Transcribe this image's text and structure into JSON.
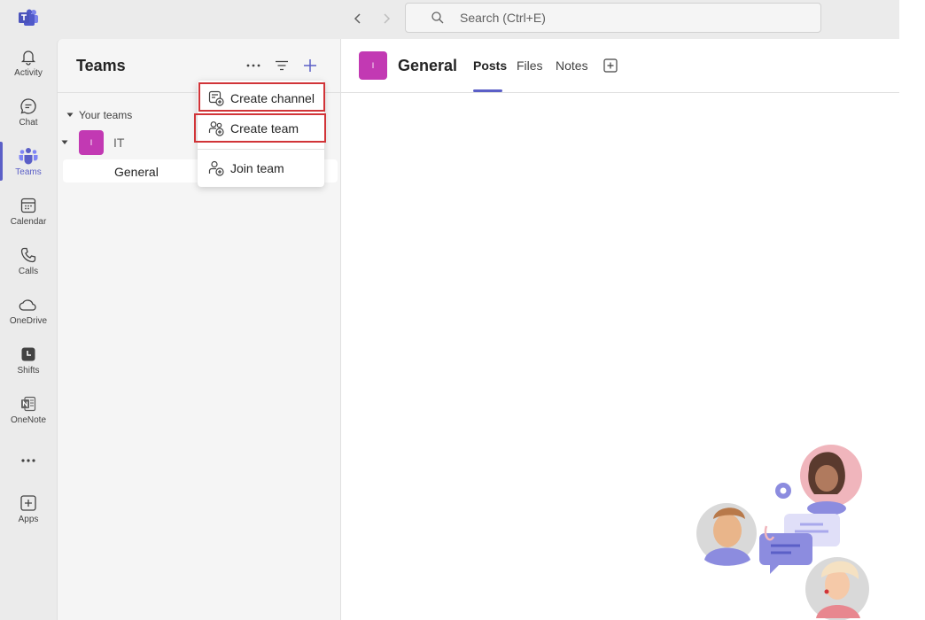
{
  "search": {
    "placeholder": "Search (Ctrl+E)"
  },
  "rail": {
    "items": [
      {
        "label": "Activity",
        "icon": "bell-icon"
      },
      {
        "label": "Chat",
        "icon": "chat-icon"
      },
      {
        "label": "Teams",
        "icon": "teams-icon",
        "active": true
      },
      {
        "label": "Calendar",
        "icon": "calendar-icon"
      },
      {
        "label": "Calls",
        "icon": "phone-icon"
      },
      {
        "label": "OneDrive",
        "icon": "cloud-icon"
      },
      {
        "label": "Shifts",
        "icon": "shifts-icon"
      },
      {
        "label": "OneNote",
        "icon": "onenote-icon"
      },
      {
        "label": "",
        "icon": "more-icon"
      },
      {
        "label": "Apps",
        "icon": "apps-icon"
      }
    ]
  },
  "pane": {
    "title": "Teams",
    "section_label": "Your teams",
    "team": {
      "initial": "I",
      "name": "IT"
    },
    "channel": "General"
  },
  "menu": {
    "items": [
      {
        "label": "Create channel",
        "icon": "create-channel-icon"
      },
      {
        "label": "Create team",
        "icon": "create-team-icon"
      },
      {
        "label": "Join team",
        "icon": "join-team-icon"
      }
    ]
  },
  "main": {
    "channel_initial": "I",
    "title": "General",
    "tabs": [
      {
        "label": "Posts",
        "active": true
      },
      {
        "label": "Files"
      },
      {
        "label": "Notes"
      }
    ]
  },
  "colors": {
    "accent": "#5b5fc7",
    "team": "#c239b3",
    "highlight": "#d13438"
  }
}
